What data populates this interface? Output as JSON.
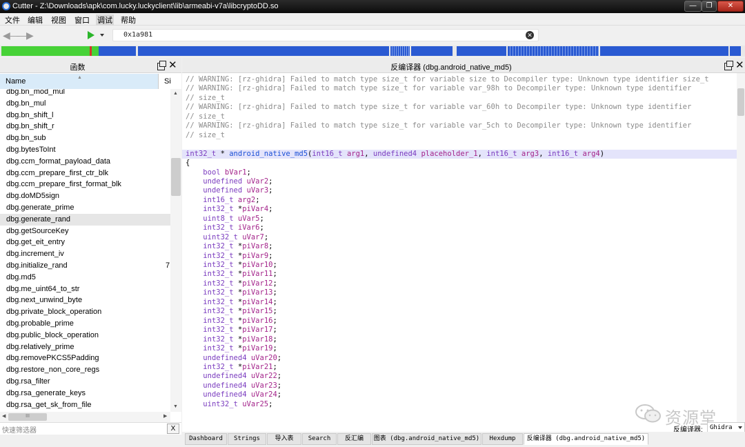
{
  "window": {
    "title": "Cutter - Z:\\Downloads\\apk\\com.lucky.luckyclient\\lib\\armeabi-v7a\\libcryptoDD.so",
    "controls": [
      "—",
      "❐",
      "✕"
    ]
  },
  "menu": [
    "文件",
    "编辑",
    "视图",
    "窗口",
    "调试",
    "帮助"
  ],
  "toolbar": {
    "address": "0x1a981",
    "clear_symbol": "✕"
  },
  "overview_colors": {
    "code": "#2a5ad2",
    "functions": "#47d237",
    "symbols": "#d2372a",
    "empty": "#e8e8e8"
  },
  "functions_panel": {
    "title": "函数",
    "columns": {
      "name": "Name",
      "size": "Si"
    },
    "items": [
      {
        "name": "dbg.bn_mod_mul"
      },
      {
        "name": "dbg.bn_mul"
      },
      {
        "name": "dbg.bn_shift_l"
      },
      {
        "name": "dbg.bn_shift_r"
      },
      {
        "name": "dbg.bn_sub"
      },
      {
        "name": "dbg.bytesToInt"
      },
      {
        "name": "dbg.ccm_format_payload_data"
      },
      {
        "name": "dbg.ccm_prepare_first_ctr_blk"
      },
      {
        "name": "dbg.ccm_prepare_first_format_blk"
      },
      {
        "name": "dbg.doMD5sign"
      },
      {
        "name": "dbg.generate_prime"
      },
      {
        "name": "dbg.generate_rand",
        "selected": true
      },
      {
        "name": "dbg.getSourceKey"
      },
      {
        "name": "dbg.get_eit_entry"
      },
      {
        "name": "dbg.increment_iv"
      },
      {
        "name": "dbg.initialize_rand",
        "size": "7"
      },
      {
        "name": "dbg.md5"
      },
      {
        "name": "dbg.me_uint64_to_str"
      },
      {
        "name": "dbg.next_unwind_byte"
      },
      {
        "name": "dbg.private_block_operation"
      },
      {
        "name": "dbg.probable_prime"
      },
      {
        "name": "dbg.public_block_operation"
      },
      {
        "name": "dbg.relatively_prime"
      },
      {
        "name": "dbg.removePKCS5Padding"
      },
      {
        "name": "dbg.restore_non_core_regs"
      },
      {
        "name": "dbg.rsa_filter"
      },
      {
        "name": "dbg.rsa_generate_keys"
      },
      {
        "name": "dbg.rsa_get_sk_from_file"
      }
    ],
    "hscroll_grip": "III"
  },
  "filter": {
    "placeholder": "快速筛选器",
    "clear": "X"
  },
  "decompiler_panel": {
    "title": "反编译器 (dbg.android_native_md5)",
    "lines": [
      [
        [
          "c-comment",
          "// WARNING: [rz-ghidra] Failed to match type size_t for variable size to Decompiler type: Unknown type identifier size_t"
        ]
      ],
      [
        [
          "c-comment",
          "// WARNING: [rz-ghidra] Failed to match type size_t for variable var_98h to Decompiler type: Unknown type identifier"
        ]
      ],
      [
        [
          "c-comment",
          "// size_t"
        ]
      ],
      [
        [
          "c-comment",
          "// WARNING: [rz-ghidra] Failed to match type size_t for variable var_60h to Decompiler type: Unknown type identifier"
        ]
      ],
      [
        [
          "c-comment",
          "// size_t"
        ]
      ],
      [
        [
          "c-comment",
          "// WARNING: [rz-ghidra] Failed to match type size_t for variable var_5ch to Decompiler type: Unknown type identifier"
        ]
      ],
      [
        [
          "c-comment",
          "// size_t"
        ]
      ],
      [],
      [
        [
          "c-type",
          "int32_t"
        ],
        [
          "c-plain",
          " * "
        ],
        [
          "c-func",
          "android_native_md5"
        ],
        [
          "c-plain",
          "("
        ],
        [
          "c-type",
          "int16_t"
        ],
        [
          "c-plain",
          " "
        ],
        [
          "c-var",
          "arg1"
        ],
        [
          "c-plain",
          ", "
        ],
        [
          "c-type",
          "undefined4"
        ],
        [
          "c-plain",
          " "
        ],
        [
          "c-var",
          "placeholder_1"
        ],
        [
          "c-plain",
          ", "
        ],
        [
          "c-type",
          "int16_t"
        ],
        [
          "c-plain",
          " "
        ],
        [
          "c-var",
          "arg3"
        ],
        [
          "c-plain",
          ", "
        ],
        [
          "c-type",
          "int16_t"
        ],
        [
          "c-plain",
          " "
        ],
        [
          "c-var",
          "arg4"
        ],
        [
          "c-plain",
          ")"
        ]
      ],
      [
        [
          "c-plain",
          "{"
        ]
      ],
      [
        [
          "c-plain",
          "    "
        ],
        [
          "c-type",
          "bool"
        ],
        [
          "c-plain",
          " "
        ],
        [
          "c-var",
          "bVar1"
        ],
        [
          "c-plain",
          ";"
        ]
      ],
      [
        [
          "c-plain",
          "    "
        ],
        [
          "c-type",
          "undefined"
        ],
        [
          "c-plain",
          " "
        ],
        [
          "c-var",
          "uVar2"
        ],
        [
          "c-plain",
          ";"
        ]
      ],
      [
        [
          "c-plain",
          "    "
        ],
        [
          "c-type",
          "undefined"
        ],
        [
          "c-plain",
          " "
        ],
        [
          "c-var",
          "uVar3"
        ],
        [
          "c-plain",
          ";"
        ]
      ],
      [
        [
          "c-plain",
          "    "
        ],
        [
          "c-type",
          "int16_t"
        ],
        [
          "c-plain",
          " "
        ],
        [
          "c-var",
          "arg2"
        ],
        [
          "c-plain",
          ";"
        ]
      ],
      [
        [
          "c-plain",
          "    "
        ],
        [
          "c-type",
          "int32_t"
        ],
        [
          "c-plain",
          " *"
        ],
        [
          "c-var",
          "piVar4"
        ],
        [
          "c-plain",
          ";"
        ]
      ],
      [
        [
          "c-plain",
          "    "
        ],
        [
          "c-type",
          "uint8_t"
        ],
        [
          "c-plain",
          " "
        ],
        [
          "c-var",
          "uVar5"
        ],
        [
          "c-plain",
          ";"
        ]
      ],
      [
        [
          "c-plain",
          "    "
        ],
        [
          "c-type",
          "int32_t"
        ],
        [
          "c-plain",
          " "
        ],
        [
          "c-var",
          "iVar6"
        ],
        [
          "c-plain",
          ";"
        ]
      ],
      [
        [
          "c-plain",
          "    "
        ],
        [
          "c-type",
          "uint32_t"
        ],
        [
          "c-plain",
          " "
        ],
        [
          "c-var",
          "uVar7"
        ],
        [
          "c-plain",
          ";"
        ]
      ],
      [
        [
          "c-plain",
          "    "
        ],
        [
          "c-type",
          "int32_t"
        ],
        [
          "c-plain",
          " *"
        ],
        [
          "c-var",
          "piVar8"
        ],
        [
          "c-plain",
          ";"
        ]
      ],
      [
        [
          "c-plain",
          "    "
        ],
        [
          "c-type",
          "int32_t"
        ],
        [
          "c-plain",
          " *"
        ],
        [
          "c-var",
          "piVar9"
        ],
        [
          "c-plain",
          ";"
        ]
      ],
      [
        [
          "c-plain",
          "    "
        ],
        [
          "c-type",
          "int32_t"
        ],
        [
          "c-plain",
          " *"
        ],
        [
          "c-var",
          "piVar10"
        ],
        [
          "c-plain",
          ";"
        ]
      ],
      [
        [
          "c-plain",
          "    "
        ],
        [
          "c-type",
          "int32_t"
        ],
        [
          "c-plain",
          " *"
        ],
        [
          "c-var",
          "piVar11"
        ],
        [
          "c-plain",
          ";"
        ]
      ],
      [
        [
          "c-plain",
          "    "
        ],
        [
          "c-type",
          "int32_t"
        ],
        [
          "c-plain",
          " *"
        ],
        [
          "c-var",
          "piVar12"
        ],
        [
          "c-plain",
          ";"
        ]
      ],
      [
        [
          "c-plain",
          "    "
        ],
        [
          "c-type",
          "int32_t"
        ],
        [
          "c-plain",
          " *"
        ],
        [
          "c-var",
          "piVar13"
        ],
        [
          "c-plain",
          ";"
        ]
      ],
      [
        [
          "c-plain",
          "    "
        ],
        [
          "c-type",
          "int32_t"
        ],
        [
          "c-plain",
          " *"
        ],
        [
          "c-var",
          "piVar14"
        ],
        [
          "c-plain",
          ";"
        ]
      ],
      [
        [
          "c-plain",
          "    "
        ],
        [
          "c-type",
          "int32_t"
        ],
        [
          "c-plain",
          " *"
        ],
        [
          "c-var",
          "piVar15"
        ],
        [
          "c-plain",
          ";"
        ]
      ],
      [
        [
          "c-plain",
          "    "
        ],
        [
          "c-type",
          "int32_t"
        ],
        [
          "c-plain",
          " *"
        ],
        [
          "c-var",
          "piVar16"
        ],
        [
          "c-plain",
          ";"
        ]
      ],
      [
        [
          "c-plain",
          "    "
        ],
        [
          "c-type",
          "int32_t"
        ],
        [
          "c-plain",
          " *"
        ],
        [
          "c-var",
          "piVar17"
        ],
        [
          "c-plain",
          ";"
        ]
      ],
      [
        [
          "c-plain",
          "    "
        ],
        [
          "c-type",
          "int32_t"
        ],
        [
          "c-plain",
          " *"
        ],
        [
          "c-var",
          "piVar18"
        ],
        [
          "c-plain",
          ";"
        ]
      ],
      [
        [
          "c-plain",
          "    "
        ],
        [
          "c-type",
          "int32_t"
        ],
        [
          "c-plain",
          " *"
        ],
        [
          "c-var",
          "piVar19"
        ],
        [
          "c-plain",
          ";"
        ]
      ],
      [
        [
          "c-plain",
          "    "
        ],
        [
          "c-type",
          "undefined4"
        ],
        [
          "c-plain",
          " "
        ],
        [
          "c-var",
          "uVar20"
        ],
        [
          "c-plain",
          ";"
        ]
      ],
      [
        [
          "c-plain",
          "    "
        ],
        [
          "c-type",
          "int32_t"
        ],
        [
          "c-plain",
          " *"
        ],
        [
          "c-var",
          "piVar21"
        ],
        [
          "c-plain",
          ";"
        ]
      ],
      [
        [
          "c-plain",
          "    "
        ],
        [
          "c-type",
          "undefined4"
        ],
        [
          "c-plain",
          " "
        ],
        [
          "c-var",
          "uVar22"
        ],
        [
          "c-plain",
          ";"
        ]
      ],
      [
        [
          "c-plain",
          "    "
        ],
        [
          "c-type",
          "undefined4"
        ],
        [
          "c-plain",
          " "
        ],
        [
          "c-var",
          "uVar23"
        ],
        [
          "c-plain",
          ";"
        ]
      ],
      [
        [
          "c-plain",
          "    "
        ],
        [
          "c-type",
          "undefined4"
        ],
        [
          "c-plain",
          " "
        ],
        [
          "c-var",
          "uVar24"
        ],
        [
          "c-plain",
          ";"
        ]
      ],
      [
        [
          "c-plain",
          "    "
        ],
        [
          "c-type",
          "uint32_t"
        ],
        [
          "c-plain",
          " "
        ],
        [
          "c-var",
          "uVar25"
        ],
        [
          "c-plain",
          ";"
        ]
      ]
    ]
  },
  "bottom_tabs": [
    {
      "label": "Dashboard"
    },
    {
      "label": "Strings"
    },
    {
      "label": "导入表"
    },
    {
      "label": "Search"
    },
    {
      "label": "反汇编"
    },
    {
      "label": "图表 (dbg.android_native_md5)"
    },
    {
      "label": "Hexdump"
    },
    {
      "label": "反编译器 (dbg.android_native_md5)",
      "active": true
    }
  ],
  "decompiler_selector": {
    "label": "反编译器:",
    "value": "Ghidra"
  },
  "watermark": {
    "text": "资源堂"
  }
}
